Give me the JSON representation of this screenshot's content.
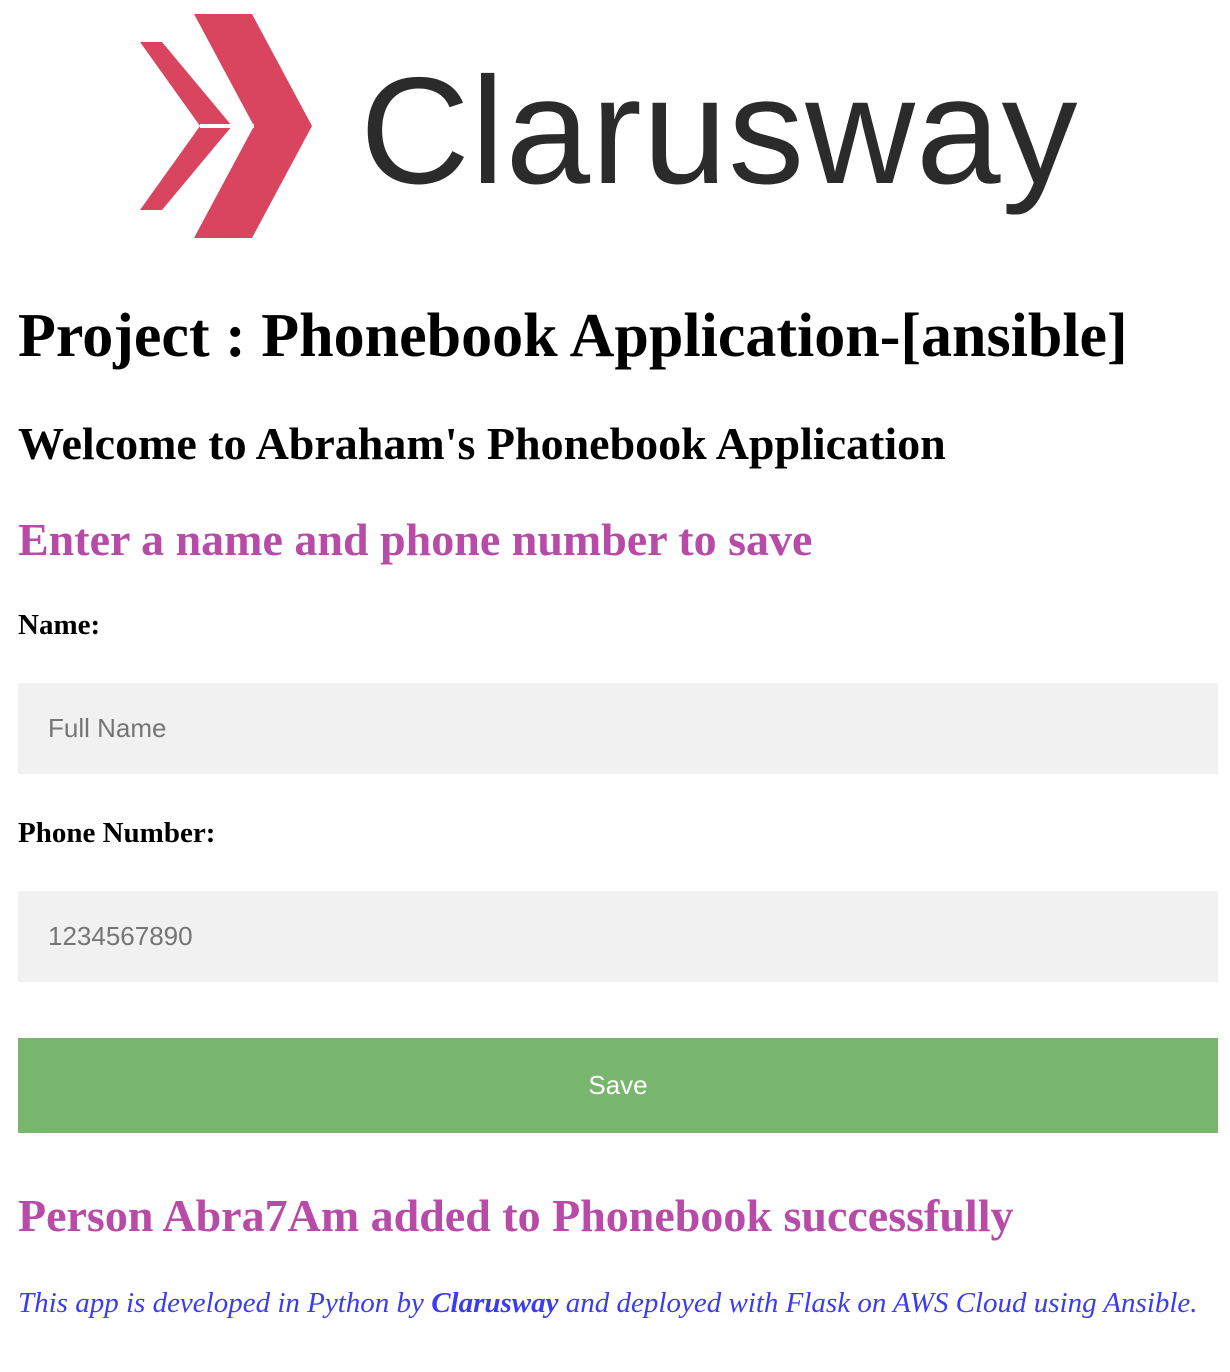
{
  "logo": {
    "text": "Clarusway",
    "brand_color": "#d9455f",
    "text_color": "#2b2b2b"
  },
  "project_title": "Project : Phonebook Application-[ansible]",
  "welcome": "Welcome to Abraham's Phonebook Application",
  "instruction": "Enter a name and phone number to save",
  "form": {
    "name_label": "Name:",
    "name_placeholder": "Full Name",
    "phone_label": "Phone Number:",
    "phone_placeholder": "1234567890",
    "save_label": "Save",
    "save_color": "#79b66d"
  },
  "result_message": "Person Abra7Am added to Phonebook successfully",
  "footer": {
    "prefix": "This app is developed in Python by ",
    "link_text": "Clarusway",
    "suffix": " and deployed with Flask on AWS Cloud using Ansible."
  }
}
